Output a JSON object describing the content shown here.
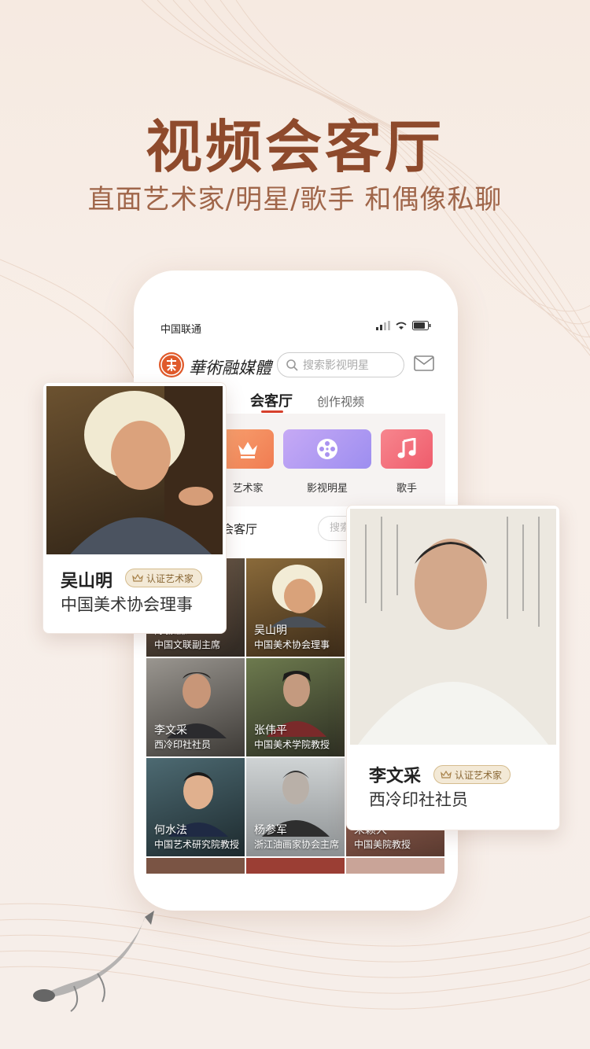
{
  "promo": {
    "headline": "视频会客厅",
    "subheadline": "直面艺术家/明星/歌手 和偶像私聊"
  },
  "status_bar": {
    "carrier": "中国联通"
  },
  "app_header": {
    "logo_text": "華術融媒體",
    "search_placeholder": "搜索影视明星"
  },
  "tabs": [
    {
      "label": "会客厅",
      "active": true
    },
    {
      "label": "创作视频",
      "active": false
    }
  ],
  "categories": [
    {
      "label": "艺术家",
      "icon": "crown-icon",
      "color": "#f58a5c"
    },
    {
      "label": "影视明星",
      "icon": "film-reel-icon",
      "color": "#a98ef0"
    },
    {
      "label": "歌手",
      "icon": "music-note-icon",
      "color": "#f06675"
    }
  ],
  "hall": {
    "title": "会客厅",
    "search_placeholder": "搜索"
  },
  "grid": [
    {
      "name": "陈振濂",
      "title": "中国文联副主席"
    },
    {
      "name": "吴山明",
      "title": "中国美术协会理事"
    },
    {
      "name": "",
      "title": ""
    },
    {
      "name": "李文采",
      "title": "西冷印社社员"
    },
    {
      "name": "张伟平",
      "title": "中国美术学院教授"
    },
    {
      "name": "",
      "title": ""
    },
    {
      "name": "何水法",
      "title": "中国艺术研究院教授"
    },
    {
      "name": "杨参军",
      "title": "浙江油画家协会主席"
    },
    {
      "name": "朱颖人",
      "title": "中国美院教授"
    }
  ],
  "featured_cards": [
    {
      "name": "吴山明",
      "badge": "认证艺术家",
      "title": "中国美术协会理事"
    },
    {
      "name": "李文采",
      "badge": "认证艺术家",
      "title": "西冷印社社员"
    }
  ],
  "colors": {
    "headline": "#8e4a2c",
    "accent_red": "#d6402c",
    "badge_bg": "#f3e9d6"
  }
}
